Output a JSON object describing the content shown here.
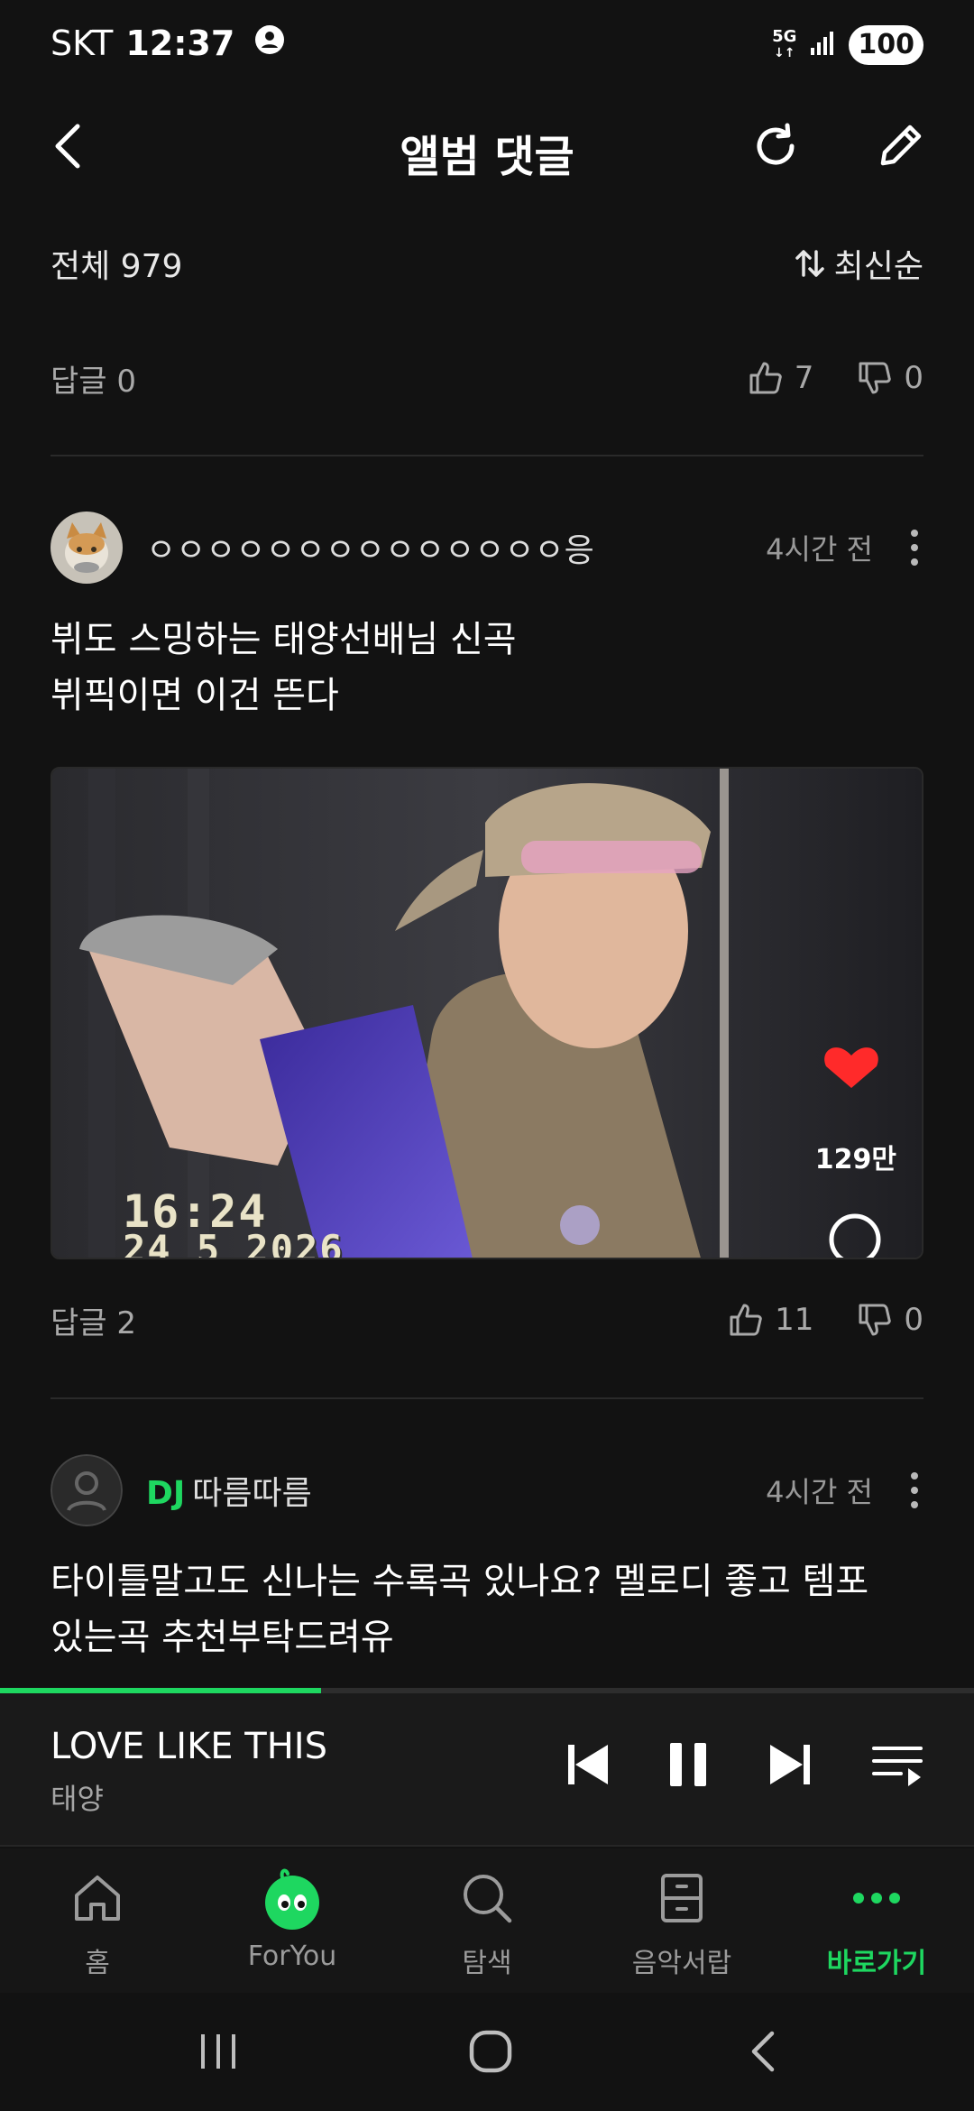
{
  "status_bar": {
    "carrier": "SKT",
    "time": "12:37",
    "network": "5G",
    "battery": "100"
  },
  "header": {
    "title": "앨범 댓글"
  },
  "sort": {
    "total_label": "전체 979",
    "order_label": "최신순"
  },
  "prev_comment": {
    "reply_label": "답글 0",
    "likes": "7",
    "dislikes": "0"
  },
  "comments": [
    {
      "author_prefix": "",
      "author": "ㅇㅇㅇㅇㅇㅇㅇㅇㅇㅇㅇㅇㅇㅇ응",
      "time": "4시간 전",
      "lines": [
        "뷔도 스밍하는 태양선배님 신곡",
        "뷔픽이면 이건 뜬다"
      ],
      "media": {
        "stamp_time": "16:24",
        "stamp_date": "24 5 2026",
        "like_count": "129만"
      },
      "reply_label": "답글 2",
      "likes": "11",
      "dislikes": "0"
    },
    {
      "author_prefix": "DJ",
      "author": "따름따름",
      "time": "4시간 전",
      "lines": [
        "타이틀말고도 신나는 수록곡 있나요? 멜로디 좋고 템포",
        "있는곡 추천부탁드려유"
      ]
    }
  ],
  "player": {
    "title": "LOVE LIKE THIS",
    "artist": "태양",
    "progress": 0.33
  },
  "bottom_nav": [
    {
      "label": "홈",
      "icon": "home-icon",
      "active": false
    },
    {
      "label": "ForYou",
      "icon": "foryou-character-icon",
      "active": false
    },
    {
      "label": "탐색",
      "icon": "search-icon",
      "active": false
    },
    {
      "label": "음악서랍",
      "icon": "drawer-icon",
      "active": false
    },
    {
      "label": "바로가기",
      "icon": "more-dots-icon",
      "active": true
    }
  ],
  "colors": {
    "accent": "#1ed760",
    "background": "#121212",
    "heart": "#ff2a2a"
  }
}
